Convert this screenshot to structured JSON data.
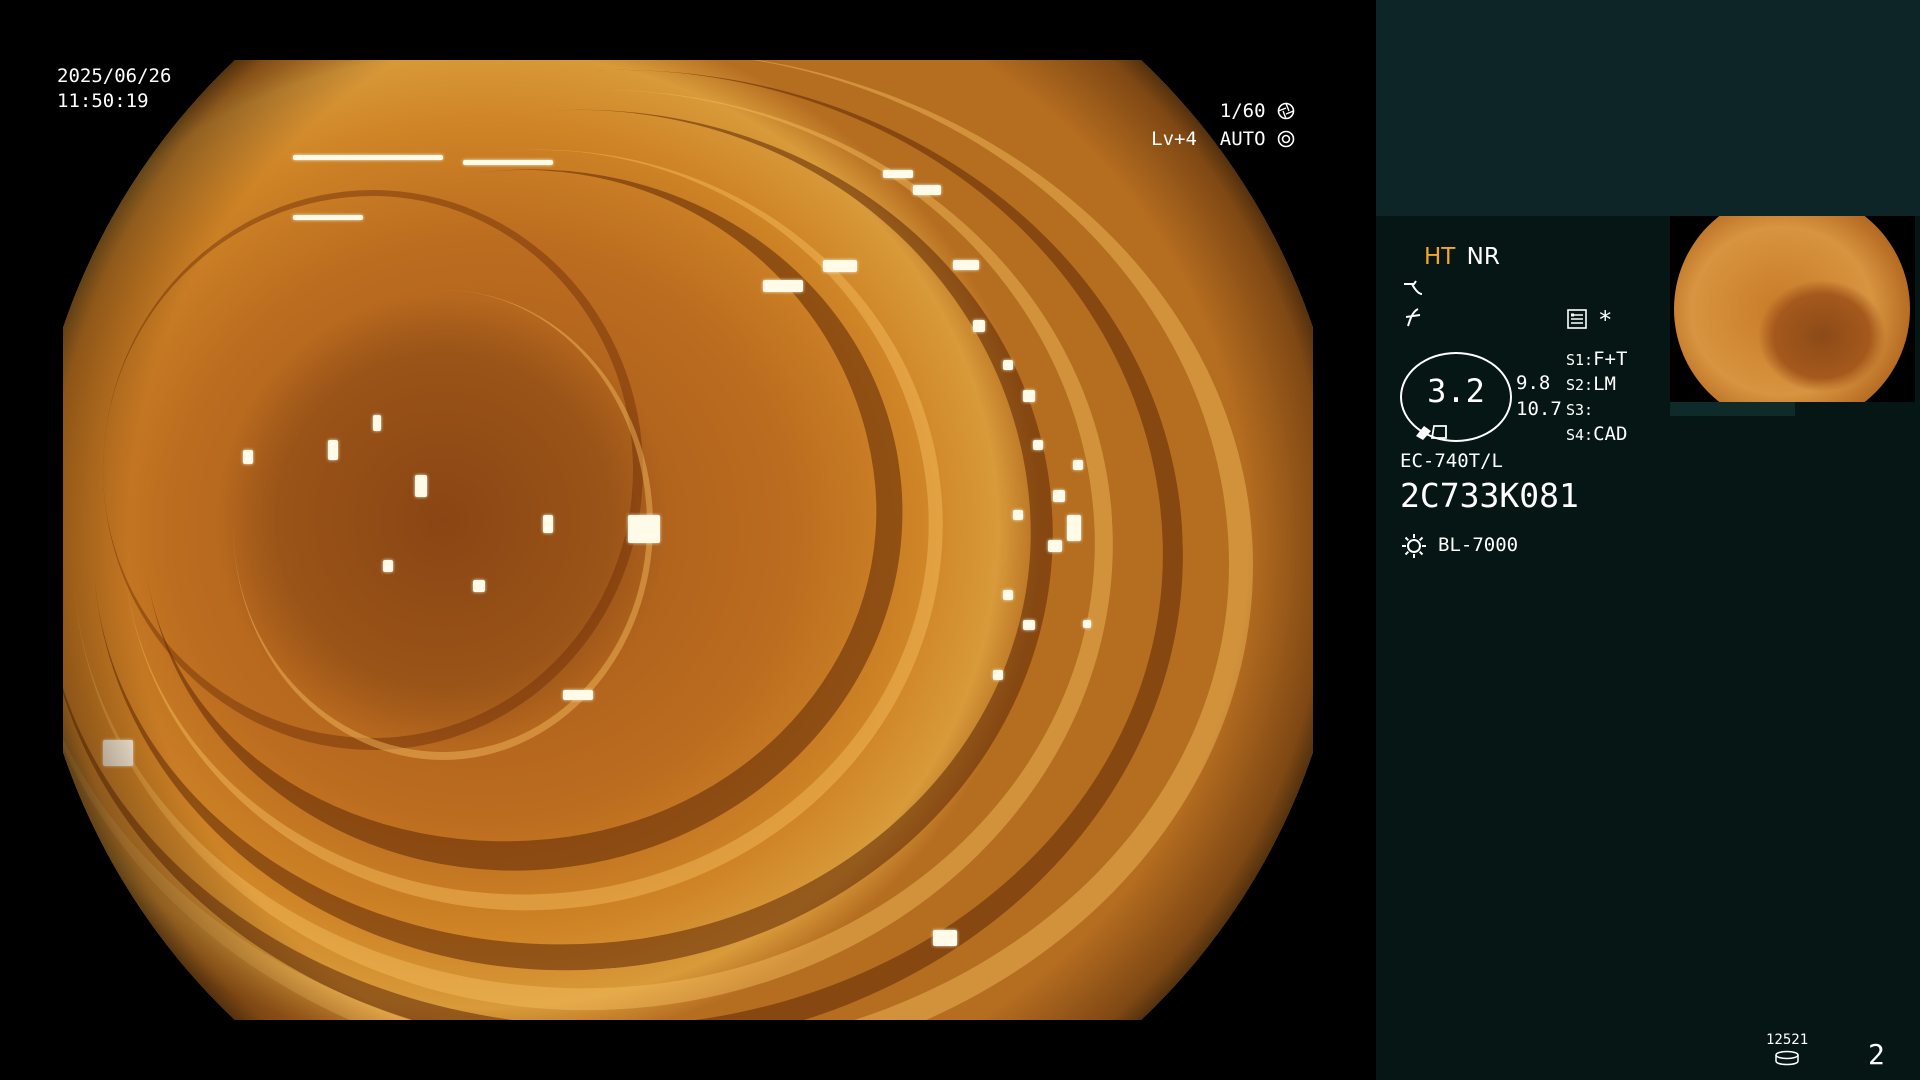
{
  "datetime": {
    "date": "2025/06/26",
    "time": "11:50:19"
  },
  "shutter": {
    "value": "1/60",
    "icon": "shutter-icon"
  },
  "exposure": {
    "value": "Lv+4  AUTO",
    "icon": "iris-icon"
  },
  "modes": {
    "ht": "HT",
    "nr": "NR",
    "ht_color": "#f5a623"
  },
  "panel_icons": [
    "enhance-curve-icon",
    "freeze-icon",
    "menu-list-icon"
  ],
  "asterisk": "*",
  "magnification": {
    "value": "3.2",
    "icon": "zoom-tool-icon"
  },
  "measure": {
    "a": "9.8",
    "b": "10.7"
  },
  "switches": [
    {
      "key": "S1:",
      "value": "F+T"
    },
    {
      "key": "S2:",
      "value": "LM"
    },
    {
      "key": "S3:",
      "value": ""
    },
    {
      "key": "S4:",
      "value": "CAD"
    }
  ],
  "scope": {
    "model": "EC-740T/L",
    "serial": "2C733K081"
  },
  "light_source": {
    "icon": "light-source-icon",
    "name": "BL-7000"
  },
  "storage": {
    "count": "12521",
    "icon": "storage-disk-icon"
  },
  "page_number": "2",
  "colors": {
    "panel": "#061614",
    "panel_top": "#0d2526",
    "tissue": "#c77a28"
  }
}
